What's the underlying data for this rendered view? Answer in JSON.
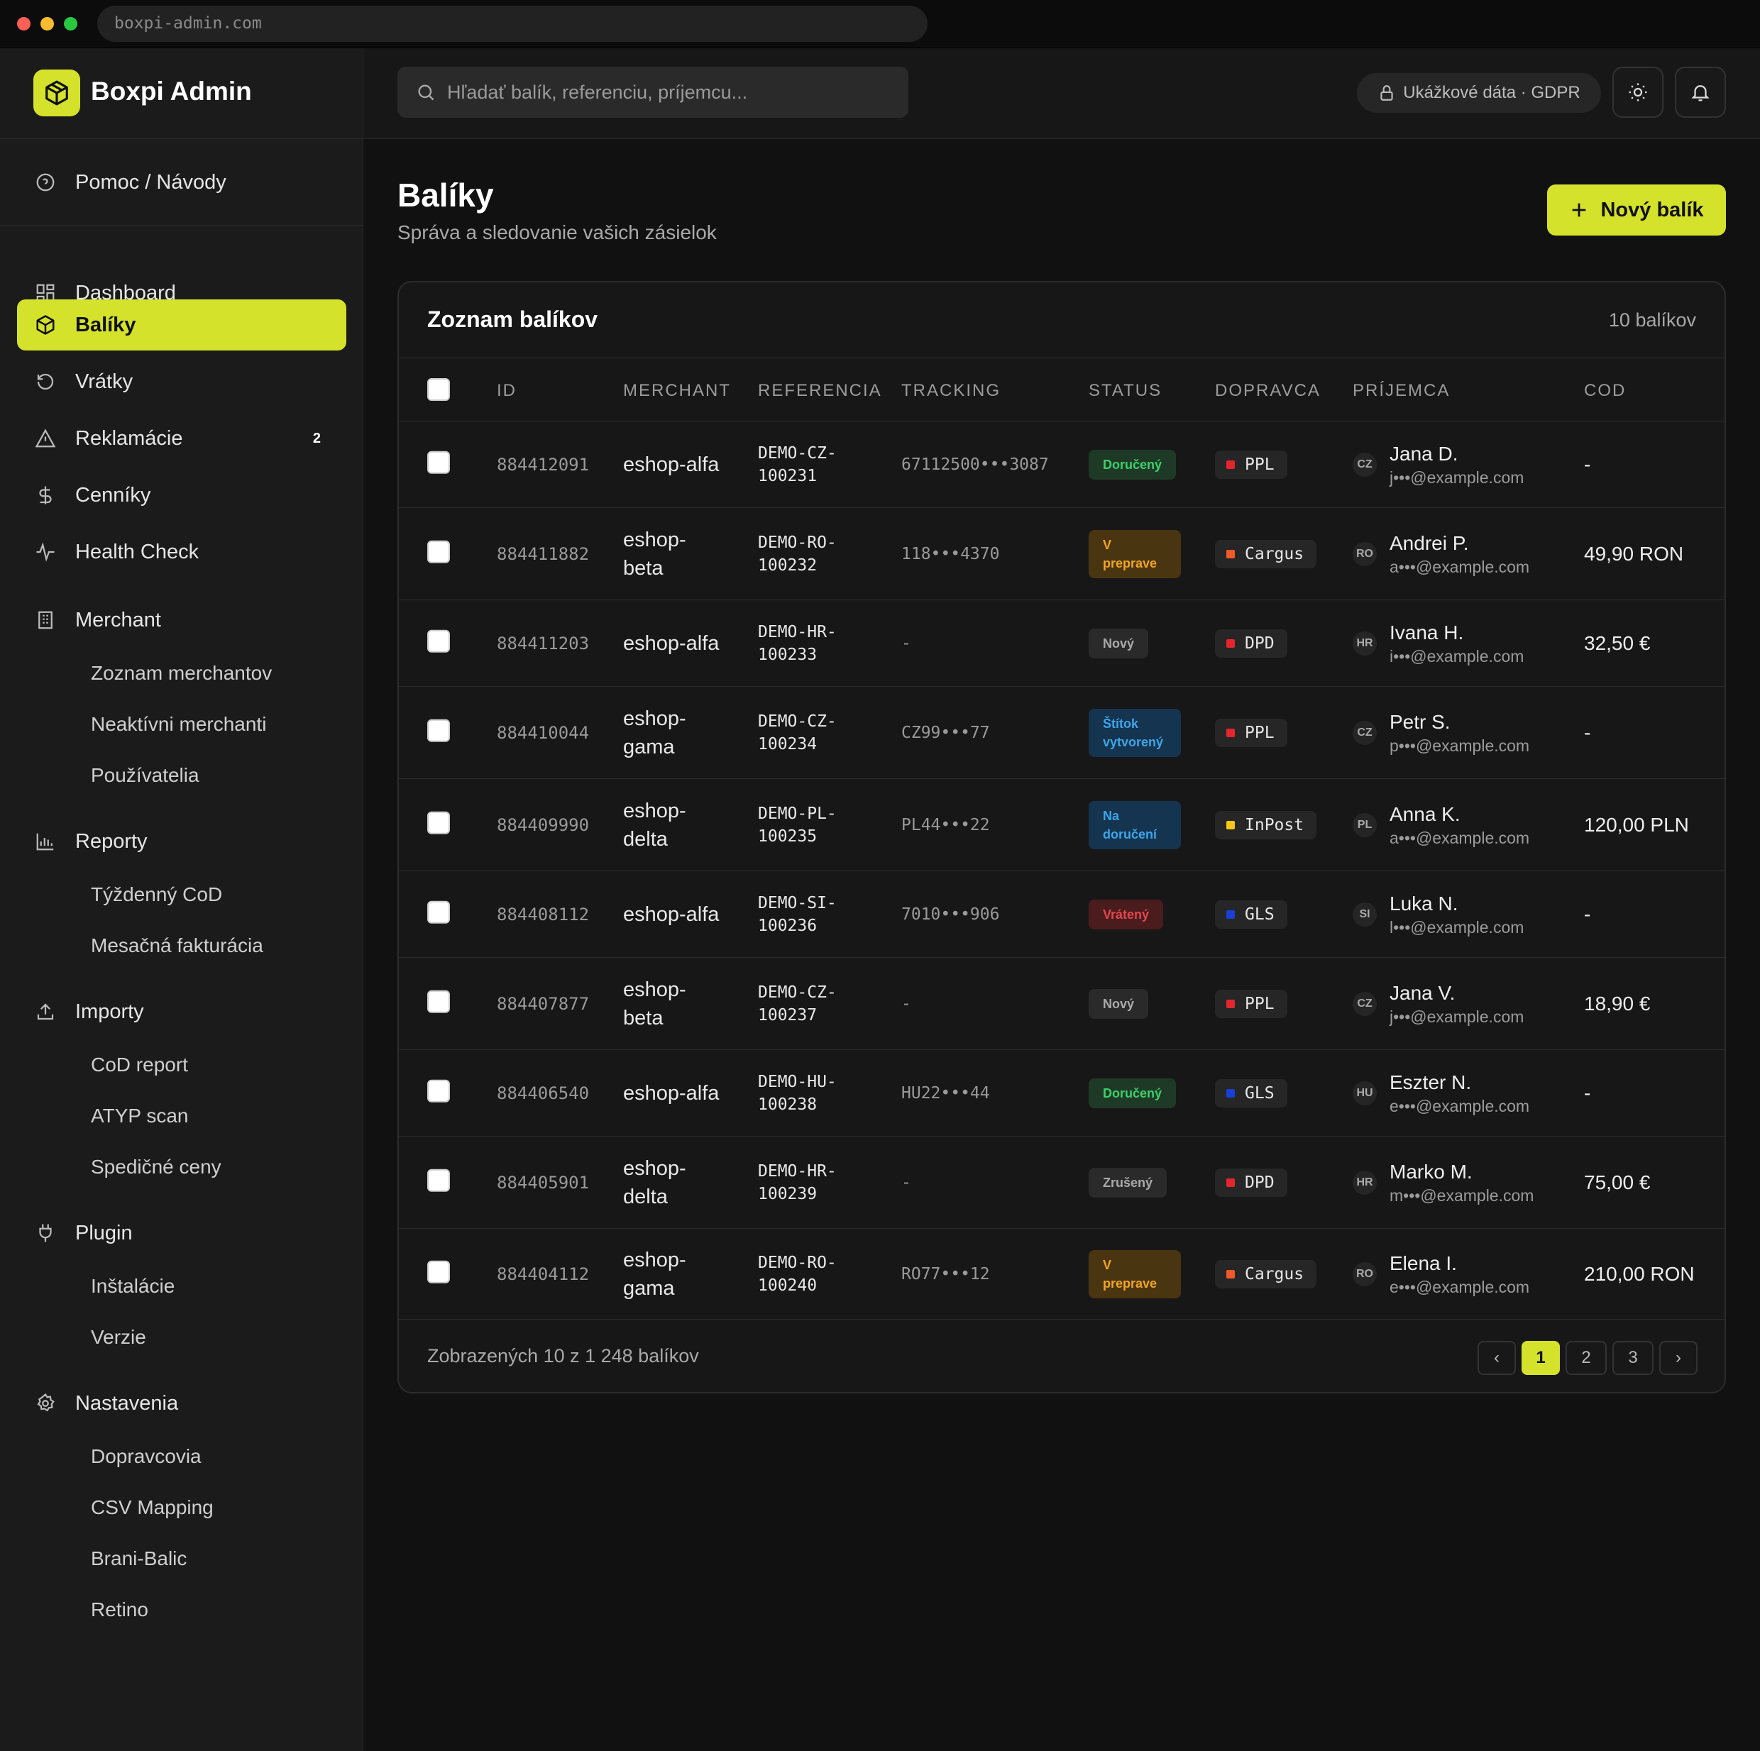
{
  "browser": {
    "url": "boxpi-admin.com"
  },
  "brand": {
    "name": "Boxpi Admin"
  },
  "sidebar": {
    "help": "Pomoc / Návody",
    "items": [
      {
        "label": "Dashboard",
        "icon": "dashboard-icon"
      },
      {
        "label": "Balíky",
        "icon": "package-icon",
        "active": true
      },
      {
        "label": "Vrátky",
        "icon": "return-icon"
      },
      {
        "label": "Reklamácie",
        "icon": "warning-icon",
        "badge": "2"
      },
      {
        "label": "Cenníky",
        "icon": "dollar-icon"
      },
      {
        "label": "Health Check",
        "icon": "pulse-icon"
      }
    ],
    "groups": [
      {
        "label": "Merchant",
        "icon": "building-icon",
        "children": [
          "Zoznam merchantov",
          "Neaktívni merchanti",
          "Používatelia"
        ]
      },
      {
        "label": "Reporty",
        "icon": "bar-chart-icon",
        "children": [
          "Týždenný CoD",
          "Mesačná fakturácia"
        ]
      },
      {
        "label": "Importy",
        "icon": "upload-icon",
        "children": [
          "CoD report",
          "ATYP scan",
          "Spedičné ceny"
        ]
      },
      {
        "label": "Plugin",
        "icon": "plug-icon",
        "children": [
          "Inštalácie",
          "Verzie"
        ]
      },
      {
        "label": "Nastavenia",
        "icon": "gear-icon",
        "children": [
          "Dopravcovia",
          "CSV Mapping",
          "Brani-Balic",
          "Retino"
        ]
      }
    ]
  },
  "topbar": {
    "search_placeholder": "Hľadať balík, referenciu, príjemcu...",
    "gdpr": "Ukážkové dáta · GDPR"
  },
  "page": {
    "title": "Balíky",
    "subtitle": "Správa a sledovanie vašich zásielok",
    "new_button": "Nový balík"
  },
  "table": {
    "title": "Zoznam balíkov",
    "count": "10 balíkov",
    "columns": [
      "ID",
      "MERCHANT",
      "REFERENCIA",
      "TRACKING",
      "STATUS",
      "DOPRAVCA",
      "PRÍJEMCA",
      "COD"
    ],
    "rows": [
      {
        "id": "884412091",
        "merchant": "eshop-alfa",
        "ref": "DEMO-CZ-100231",
        "tracking": "67112500•••3087",
        "status": "Doručený",
        "status_color": "#3ecf6b",
        "carrier": "PPL",
        "carrier_color": "#e3262e",
        "cc": "CZ",
        "name": "Jana D.",
        "email": "j•••@example.com",
        "cod": "-"
      },
      {
        "id": "884411882",
        "merchant": "eshop-beta",
        "ref": "DEMO-RO-100232",
        "tracking": "118•••4370",
        "status": "V preprave",
        "status_color": "#f0a52a",
        "carrier": "Cargus",
        "carrier_color": "#f05a28",
        "cc": "RO",
        "name": "Andrei P.",
        "email": "a•••@example.com",
        "cod": "49,90 RON"
      },
      {
        "id": "884411203",
        "merchant": "eshop-alfa",
        "ref": "DEMO-HR-100233",
        "tracking": "-",
        "status": "Nový",
        "status_color": "#aaaaaa",
        "carrier": "DPD",
        "carrier_color": "#e3262e",
        "cc": "HR",
        "name": "Ivana H.",
        "email": "i•••@example.com",
        "cod": "32,50 €"
      },
      {
        "id": "884410044",
        "merchant": "eshop-gama",
        "ref": "DEMO-CZ-100234",
        "tracking": "CZ99•••77",
        "status": "Štítok vytvorený",
        "status_color": "#3fa5e8",
        "carrier": "PPL",
        "carrier_color": "#e3262e",
        "cc": "CZ",
        "name": "Petr S.",
        "email": "p•••@example.com",
        "cod": "-"
      },
      {
        "id": "884409990",
        "merchant": "eshop-delta",
        "ref": "DEMO-PL-100235",
        "tracking": "PL44•••22",
        "status": "Na doručení",
        "status_color": "#3fa5e8",
        "carrier": "InPost",
        "carrier_color": "#f5c518",
        "cc": "PL",
        "name": "Anna K.",
        "email": "a•••@example.com",
        "cod": "120,00 PLN"
      },
      {
        "id": "884408112",
        "merchant": "eshop-alfa",
        "ref": "DEMO-SI-100236",
        "tracking": "7010•••906",
        "status": "Vrátený",
        "status_color": "#e2474b",
        "carrier": "GLS",
        "carrier_color": "#1a3fd6",
        "cc": "SI",
        "name": "Luka N.",
        "email": "l•••@example.com",
        "cod": "-"
      },
      {
        "id": "884407877",
        "merchant": "eshop-beta",
        "ref": "DEMO-CZ-100237",
        "tracking": "-",
        "status": "Nový",
        "status_color": "#aaaaaa",
        "carrier": "PPL",
        "carrier_color": "#e3262e",
        "cc": "CZ",
        "name": "Jana V.",
        "email": "j•••@example.com",
        "cod": "18,90 €"
      },
      {
        "id": "884406540",
        "merchant": "eshop-alfa",
        "ref": "DEMO-HU-100238",
        "tracking": "HU22•••44",
        "status": "Doručený",
        "status_color": "#3ecf6b",
        "carrier": "GLS",
        "carrier_color": "#1a3fd6",
        "cc": "HU",
        "name": "Eszter N.",
        "email": "e•••@example.com",
        "cod": "-"
      },
      {
        "id": "884405901",
        "merchant": "eshop-delta",
        "ref": "DEMO-HR-100239",
        "tracking": "-",
        "status": "Zrušený",
        "status_color": "#aaaaaa",
        "carrier": "DPD",
        "carrier_color": "#e3262e",
        "cc": "HR",
        "name": "Marko M.",
        "email": "m•••@example.com",
        "cod": "75,00 €"
      },
      {
        "id": "884404112",
        "merchant": "eshop-gama",
        "ref": "DEMO-RO-100240",
        "tracking": "RO77•••12",
        "status": "V preprave",
        "status_color": "#f0a52a",
        "carrier": "Cargus",
        "carrier_color": "#f05a28",
        "cc": "RO",
        "name": "Elena I.",
        "email": "e•••@example.com",
        "cod": "210,00 RON"
      }
    ],
    "footer": "Zobrazených 10 z 1 248 balíkov",
    "pagination": {
      "prev": "‹",
      "pages": [
        "1",
        "2",
        "3"
      ],
      "current": "1",
      "next": "›"
    }
  }
}
